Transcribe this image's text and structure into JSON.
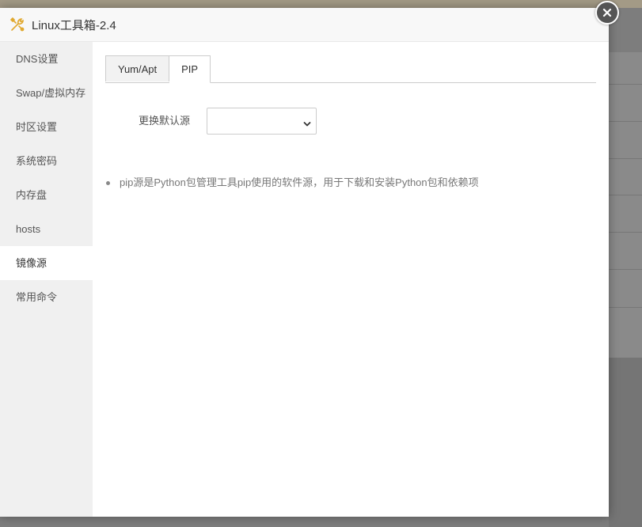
{
  "dialog": {
    "title": "Linux工具箱-2.4",
    "app_icon": "tools-icon",
    "close_icon": "close-icon"
  },
  "sidebar": {
    "items": [
      {
        "label": "DNS设置"
      },
      {
        "label": "Swap/虚拟内存"
      },
      {
        "label": "时区设置"
      },
      {
        "label": "系统密码"
      },
      {
        "label": "内存盘"
      },
      {
        "label": "hosts"
      },
      {
        "label": "镜像源",
        "active": true
      },
      {
        "label": "常用命令"
      }
    ]
  },
  "main": {
    "tabs": [
      {
        "label": "Yum/Apt"
      },
      {
        "label": "PIP",
        "active": true
      }
    ],
    "form": {
      "label": "更换默认源",
      "select_value": ""
    },
    "tips": [
      "pip源是Python包管理工具pip使用的软件源，用于下载和安装Python包和依赖项"
    ]
  },
  "colors": {
    "accent_icon": "#e0a82e",
    "sidebar_bg": "#f0f0f0",
    "header_bg": "#f8f8f8"
  }
}
